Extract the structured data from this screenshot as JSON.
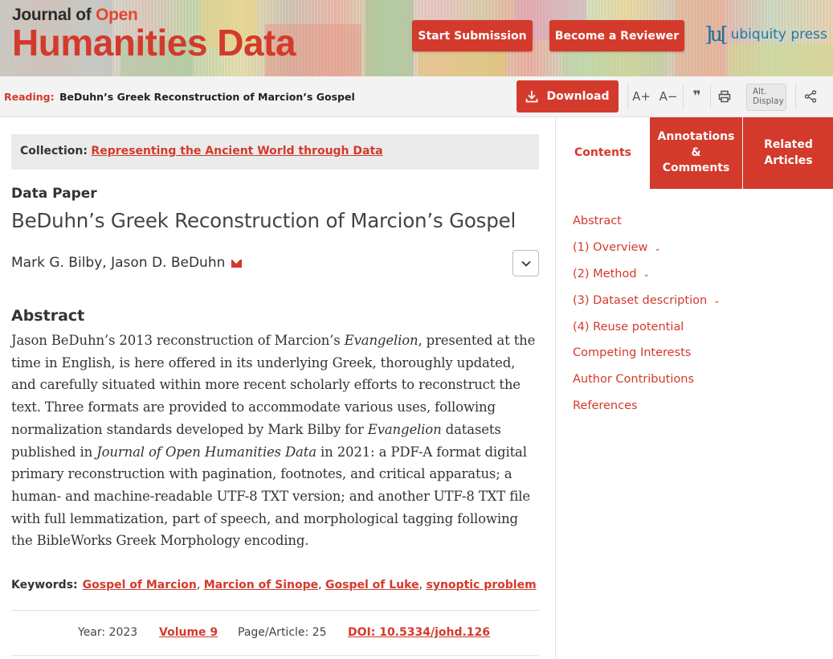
{
  "header": {
    "logo_line1": "Journal of",
    "logo_line1_accent": "Open",
    "logo_line2": "Humanities Data",
    "start_submission": "Start Submission",
    "become_reviewer": "Become a Reviewer",
    "brand_mark": "]u[",
    "brand_name": "ubiquity press"
  },
  "toolbar": {
    "reading_label": "Reading:",
    "reading_title": "BeDuhn’s Greek Reconstruction of Marcion’s Gospel",
    "download": "Download",
    "font_increase": "A+",
    "font_decrease": "A−",
    "cite_icon_text": "❞",
    "alt_display_line1": "Alt.",
    "alt_display_line2": "Display"
  },
  "collection": {
    "label": "Collection:",
    "value": "Representing the Ancient World through Data"
  },
  "article": {
    "type": "Data Paper",
    "title": "BeDuhn’s Greek Reconstruction of Marcion’s Gospel",
    "authors": "Mark G. Bilby, Jason D. BeDuhn",
    "abstract_heading": "Abstract",
    "abstract_parts": [
      "Jason BeDuhn’s 2013 reconstruction of Marcion’s ",
      "Evangelion",
      ", presented at the time in English, is here offered in its underlying Greek, thoroughly updated, and carefully situated within more recent scholarly efforts to reconstruct the text. Three formats are provided to accommodate various uses, following normalization standards developed by Mark Bilby for ",
      "Evangelion",
      " datasets published in ",
      "Journal of Open Humanities Data",
      " in 2021: a PDF-A format digital primary reconstruction with pagination, footnotes, and critical apparatus; a human- and machine-readable UTF-8 TXT version; and another UTF-8 TXT file with full lemmatization, part of speech, and morphological tagging following the BibleWorks Greek Morphology encoding."
    ],
    "keywords_label": "Keywords:",
    "keywords": [
      "Gospel of Marcion",
      "Marcion of Sinope",
      "Gospel of Luke",
      "synoptic problem"
    ],
    "year": "Year: 2023",
    "volume": "Volume 9",
    "page": "Page/Article: 25",
    "doi": "DOI: 10.5334/johd.126"
  },
  "sidebar": {
    "tabs": [
      {
        "label": "Contents"
      },
      {
        "label": "Annotations & Comments"
      },
      {
        "label": "Related Articles"
      }
    ],
    "toc": [
      {
        "label": "Abstract",
        "expandable": false
      },
      {
        "label": "(1) Overview",
        "expandable": true
      },
      {
        "label": "(2) Method",
        "expandable": true
      },
      {
        "label": "(3) Dataset description",
        "expandable": true
      },
      {
        "label": "(4) Reuse potential",
        "expandable": false
      },
      {
        "label": "Competing Interests",
        "expandable": false
      },
      {
        "label": "Author Contributions",
        "expandable": false
      },
      {
        "label": "References",
        "expandable": false
      }
    ]
  },
  "colors": {
    "accent": "#d33a2c",
    "brand_blue": "#1f6f9e",
    "toolbar_bg": "#f3f3f3",
    "collection_bg": "#ebebeb"
  }
}
